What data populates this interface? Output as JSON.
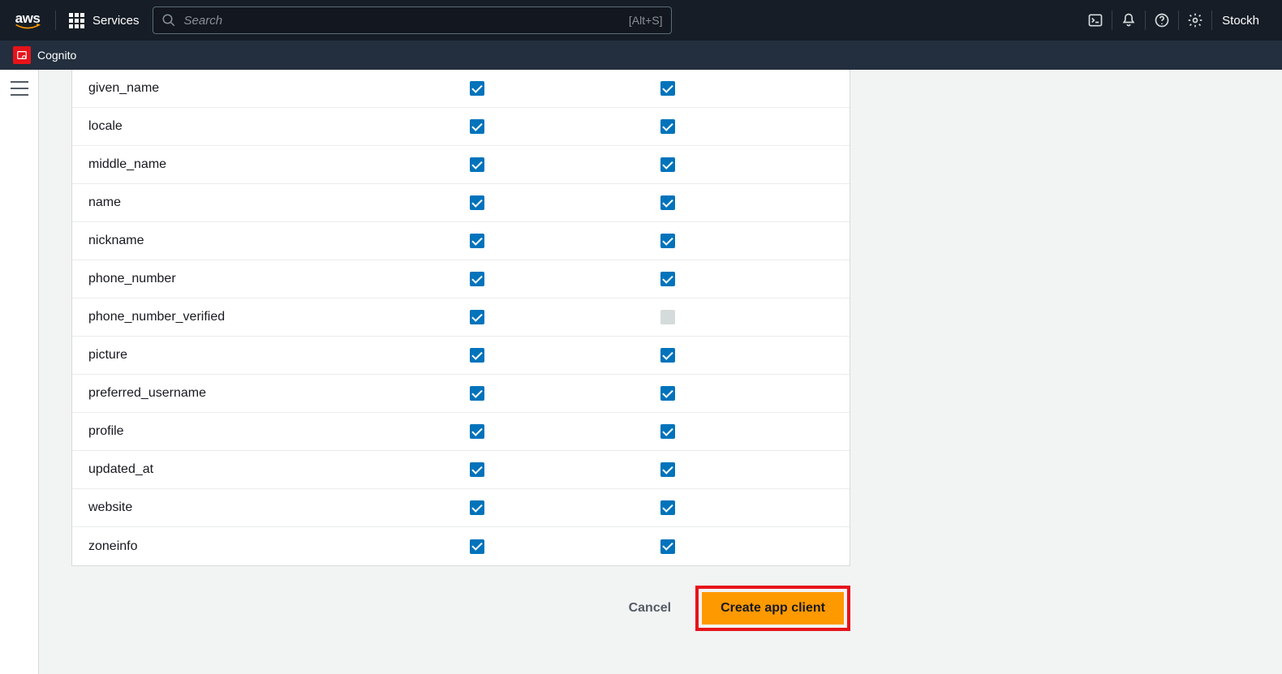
{
  "header": {
    "logo_text": "aws",
    "services_label": "Services",
    "search_placeholder": "Search",
    "search_shortcut": "[Alt+S]",
    "region": "Stockh"
  },
  "subheader": {
    "service_name": "Cognito"
  },
  "attributes": [
    {
      "name": "given_name",
      "read": true,
      "write": true,
      "write_disabled": false
    },
    {
      "name": "locale",
      "read": true,
      "write": true,
      "write_disabled": false
    },
    {
      "name": "middle_name",
      "read": true,
      "write": true,
      "write_disabled": false
    },
    {
      "name": "name",
      "read": true,
      "write": true,
      "write_disabled": false
    },
    {
      "name": "nickname",
      "read": true,
      "write": true,
      "write_disabled": false
    },
    {
      "name": "phone_number",
      "read": true,
      "write": true,
      "write_disabled": false
    },
    {
      "name": "phone_number_verified",
      "read": true,
      "write": false,
      "write_disabled": true
    },
    {
      "name": "picture",
      "read": true,
      "write": true,
      "write_disabled": false
    },
    {
      "name": "preferred_username",
      "read": true,
      "write": true,
      "write_disabled": false
    },
    {
      "name": "profile",
      "read": true,
      "write": true,
      "write_disabled": false
    },
    {
      "name": "updated_at",
      "read": true,
      "write": true,
      "write_disabled": false
    },
    {
      "name": "website",
      "read": true,
      "write": true,
      "write_disabled": false
    },
    {
      "name": "zoneinfo",
      "read": true,
      "write": true,
      "write_disabled": false
    }
  ],
  "actions": {
    "cancel": "Cancel",
    "create": "Create app client"
  }
}
